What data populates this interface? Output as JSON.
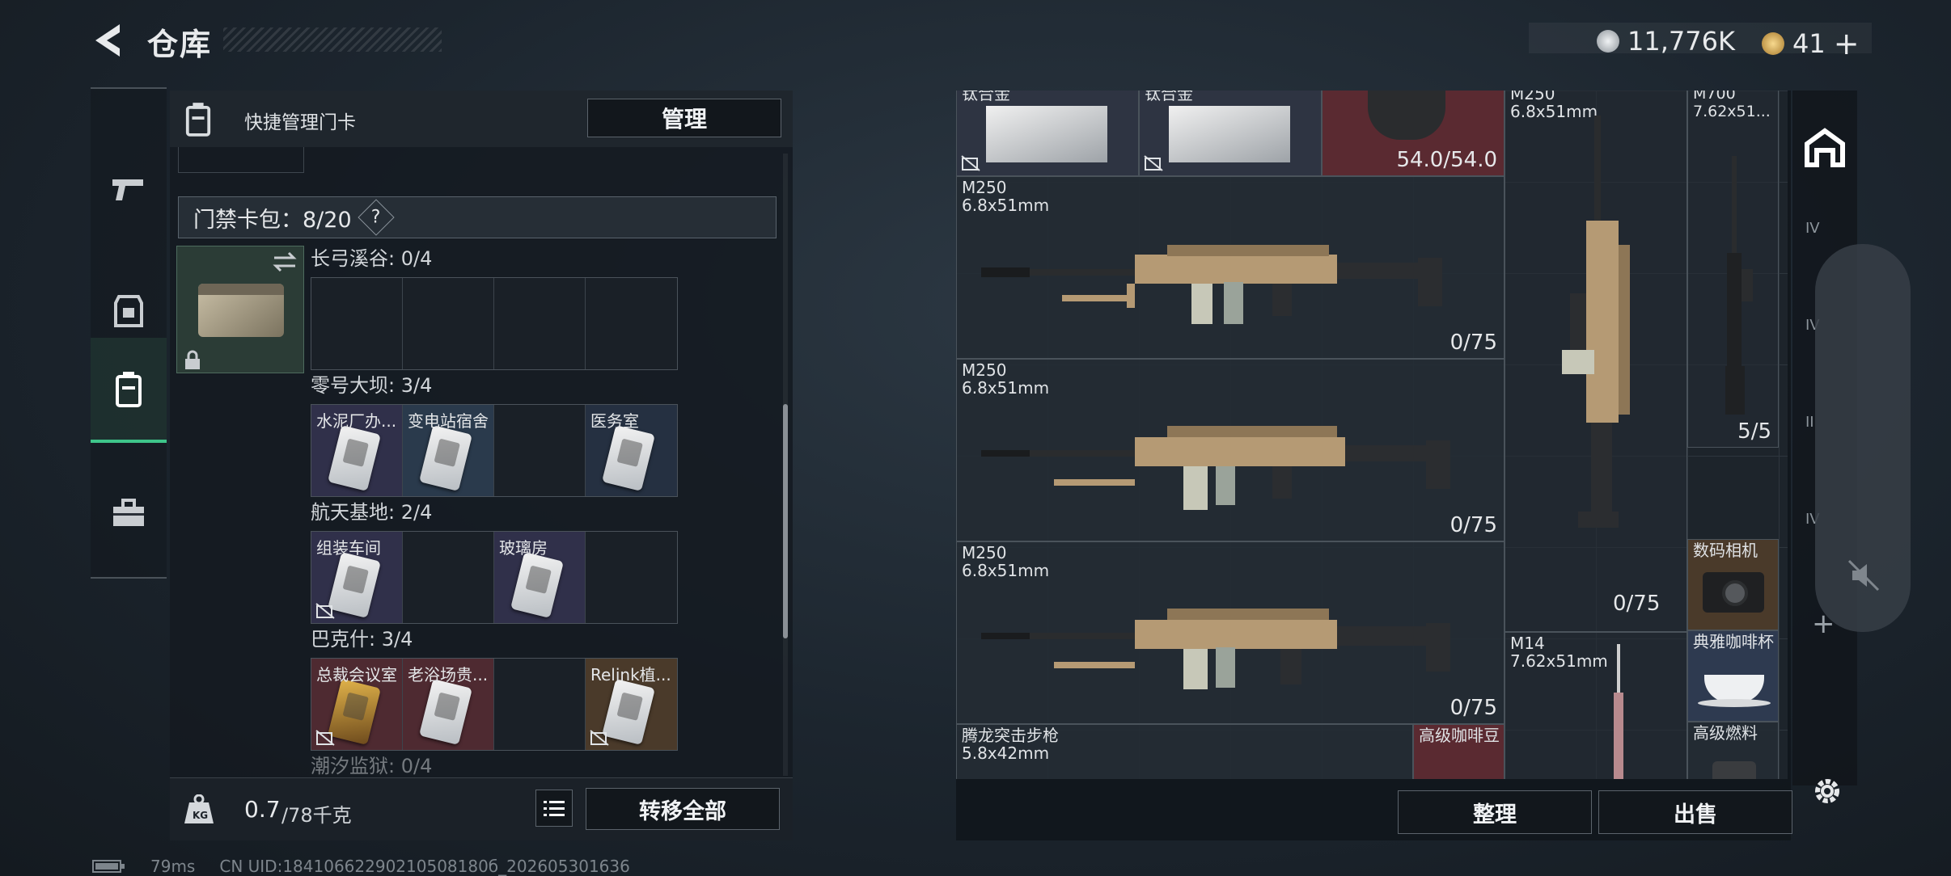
{
  "header": {
    "back_label": "back",
    "title": "仓库"
  },
  "currency": {
    "coin_value": "11,776K",
    "gold_value": "41",
    "add_symbol": "+",
    "coin_color": "#c8cdd2",
    "gold_color": "#d9b36a"
  },
  "rail": {
    "items": [
      {
        "icon": "pistol-icon"
      },
      {
        "icon": "armor-icon"
      },
      {
        "icon": "keycard-pack-icon",
        "active": true
      },
      {
        "icon": "toolbox-icon"
      }
    ]
  },
  "left_panel": {
    "quick_manage_label": "快捷管理门卡",
    "manage_button": "管理",
    "card_pack_label": "门禁卡包：8/20",
    "help_symbol": "?",
    "regions": [
      {
        "name": "长弓溪谷: 0/4",
        "cells": [
          {
            "name": "",
            "color": "empty"
          },
          {
            "name": "",
            "color": "empty"
          },
          {
            "name": "",
            "color": "empty"
          },
          {
            "name": "",
            "color": "empty"
          }
        ]
      },
      {
        "name": "零号大坝: 3/4",
        "cells": [
          {
            "name": "水泥厂办...",
            "color": "purple",
            "card": true
          },
          {
            "name": "变电站宿舍",
            "color": "blue",
            "card": true
          },
          {
            "name": "",
            "color": "empty"
          },
          {
            "name": "医务室",
            "color": "dblue",
            "card": true
          }
        ]
      },
      {
        "name": "航天基地: 2/4",
        "cells": [
          {
            "name": "组装车间",
            "color": "purple",
            "card": true,
            "nobind": true
          },
          {
            "name": "",
            "color": "empty"
          },
          {
            "name": "玻璃房",
            "color": "purple",
            "card": true
          },
          {
            "name": "",
            "color": "empty"
          }
        ]
      },
      {
        "name": "巴克什: 3/4",
        "cells": [
          {
            "name": "总裁会议室",
            "color": "red",
            "card": true,
            "gold": true,
            "nobind": true
          },
          {
            "name": "老浴场贵...",
            "color": "red",
            "card": true
          },
          {
            "name": "",
            "color": "empty"
          },
          {
            "name": "Relink植...",
            "color": "brown",
            "card": true,
            "nobind": true
          }
        ]
      },
      {
        "name": "潮汐监狱: 0/4",
        "cells": []
      }
    ],
    "weight_value": "0.7",
    "weight_unit": "/78千克",
    "transfer_all_button": "转移全部"
  },
  "right_panel": {
    "top_items": [
      {
        "name": "钛合金"
      },
      {
        "name": "钛合金"
      },
      {
        "name": "",
        "count": "54.0/54.0"
      }
    ],
    "guns": [
      {
        "name": "M250",
        "caliber": "6.8x51mm",
        "count": "0/75"
      },
      {
        "name": "M250",
        "caliber": "6.8x51mm",
        "count": "0/75"
      },
      {
        "name": "M250",
        "caliber": "6.8x51mm",
        "count": "0/75"
      },
      {
        "name": "腾龙突击步枪",
        "caliber": "5.8x42mm",
        "count": ""
      }
    ],
    "vertical_guns": [
      {
        "name": "M250",
        "caliber": "6.8x51mm",
        "count": "0/75"
      },
      {
        "name": "M700",
        "caliber": "7.62x51...",
        "count": "5/5"
      },
      {
        "name": "M14",
        "caliber": "7.62x51mm",
        "count": ""
      }
    ],
    "small_items": [
      {
        "name": "数码相机"
      },
      {
        "name": "典雅咖啡杯"
      },
      {
        "name": "高级燃料"
      },
      {
        "name": "高级咖啡豆"
      }
    ],
    "sort_button": "整理",
    "sell_button": "出售"
  },
  "side_rail": {
    "plus_symbol": "+",
    "tier_labels": [
      "IV",
      "IV",
      "II",
      "IV"
    ]
  },
  "status": {
    "ping": "79ms",
    "uid": "CN UID:18410662290210508180б_202605301636"
  }
}
